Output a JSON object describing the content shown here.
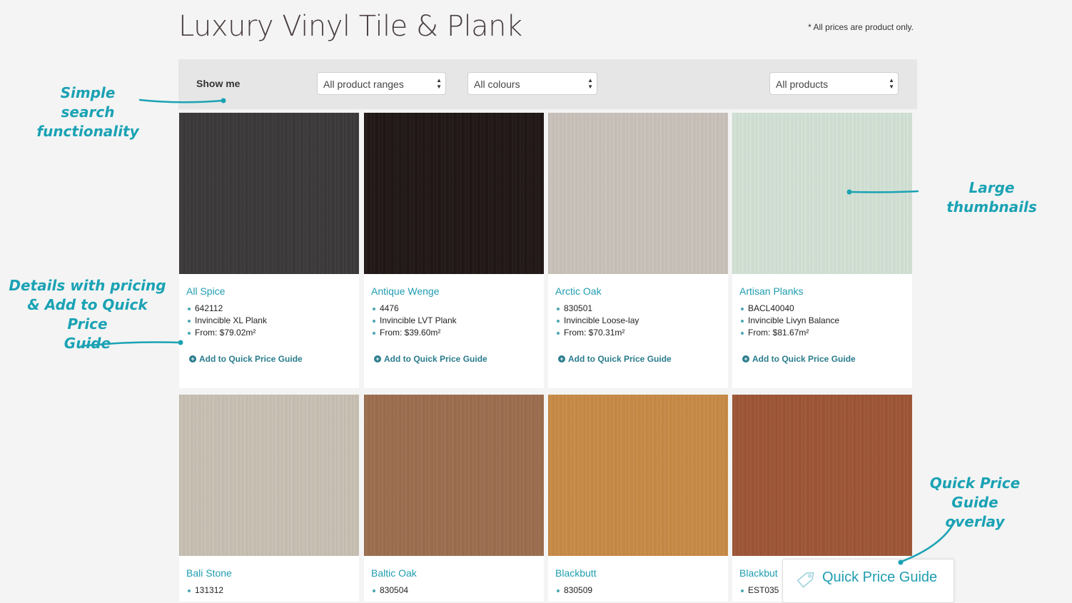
{
  "header": {
    "title": "Luxury Vinyl Tile & Plank",
    "price_note": "* All prices are product only."
  },
  "filters": {
    "label": "Show me",
    "range": "All product ranges",
    "colour": "All colours",
    "products": "All products"
  },
  "products": [
    {
      "name": "All Spice",
      "code": "642112",
      "range": "Invincible XL Plank",
      "price": "From: $79.02m²",
      "add_label": "Add to Quick Price Guide",
      "swatch": "#3a3838"
    },
    {
      "name": "Antique Wenge",
      "code": "4476",
      "range": "Invincible LVT Plank",
      "price": "From: $39.60m²",
      "add_label": "Add to Quick Price Guide",
      "swatch": "#1f1515"
    },
    {
      "name": "Arctic Oak",
      "code": "830501",
      "range": "Invincible Loose-lay",
      "price": "From: $70.31m²",
      "add_label": "Add to Quick Price Guide",
      "swatch": "#c9c2bb"
    },
    {
      "name": "Artisan Planks",
      "code": "BACL40040",
      "range": "Invincible Livyn Balance",
      "price": "From: $81.67m²",
      "add_label": "Add to Quick Price Guide",
      "swatch": "#d3e2d6"
    },
    {
      "name": "Bali Stone",
      "code": "131312",
      "swatch": "#c8c0b3"
    },
    {
      "name": "Baltic Oak",
      "code": "830504",
      "swatch": "#9c6d4e"
    },
    {
      "name": "Blackbutt",
      "code": "830509",
      "swatch": "#c88a45"
    },
    {
      "name": "Blackbut",
      "code": "EST035",
      "swatch": "#9e5535"
    }
  ],
  "annotations": {
    "search": [
      "Simple search",
      "functionality"
    ],
    "thumbnails": [
      "Large thumbnails"
    ],
    "details": [
      "Details with pricing",
      "& Add to Quick Price",
      "Guide"
    ],
    "overlay": [
      "Quick Price",
      "Guide overlay"
    ]
  },
  "quick_price_guide": {
    "label": "Quick Price Guide",
    "icon": "price-tag-icon"
  },
  "colors": {
    "accent": "#1f9db0",
    "annotation": "#1aa2b4",
    "link": "#2a7c8c"
  }
}
